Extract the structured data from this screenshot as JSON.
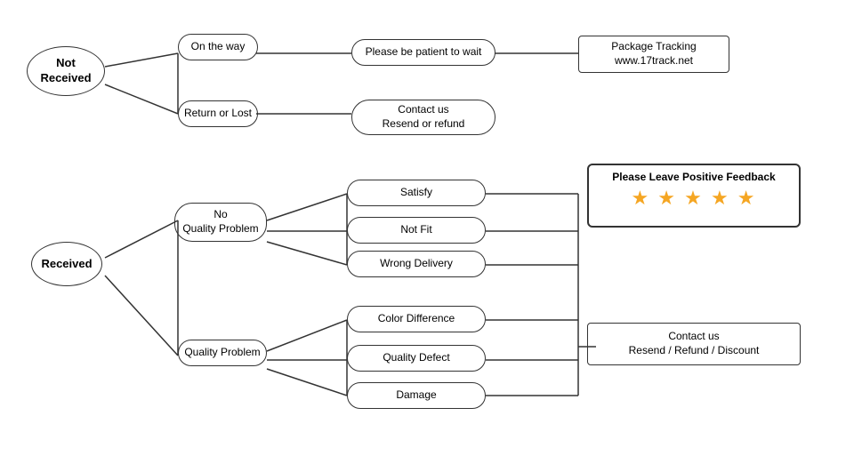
{
  "nodes": {
    "not_received": "Not\nReceived",
    "on_the_way": "On the way",
    "return_or_lost": "Return or Lost",
    "patient_wait": "Please be patient to wait",
    "package_tracking": "Package Tracking\nwww.17track.net",
    "contact_resend_refund": "Contact us\nResend or refund",
    "received": "Received",
    "no_quality_problem": "No\nQuality Problem",
    "quality_problem": "Quality Problem",
    "satisfy": "Satisfy",
    "not_fit": "Not Fit",
    "wrong_delivery": "Wrong Delivery",
    "color_difference": "Color Difference",
    "quality_defect": "Quality Defect",
    "damage": "Damage",
    "positive_feedback_title": "Please Leave Positive Feedback",
    "stars": "★ ★ ★ ★ ★",
    "contact_resend_refund_discount": "Contact us\nResend / Refund / Discount"
  }
}
